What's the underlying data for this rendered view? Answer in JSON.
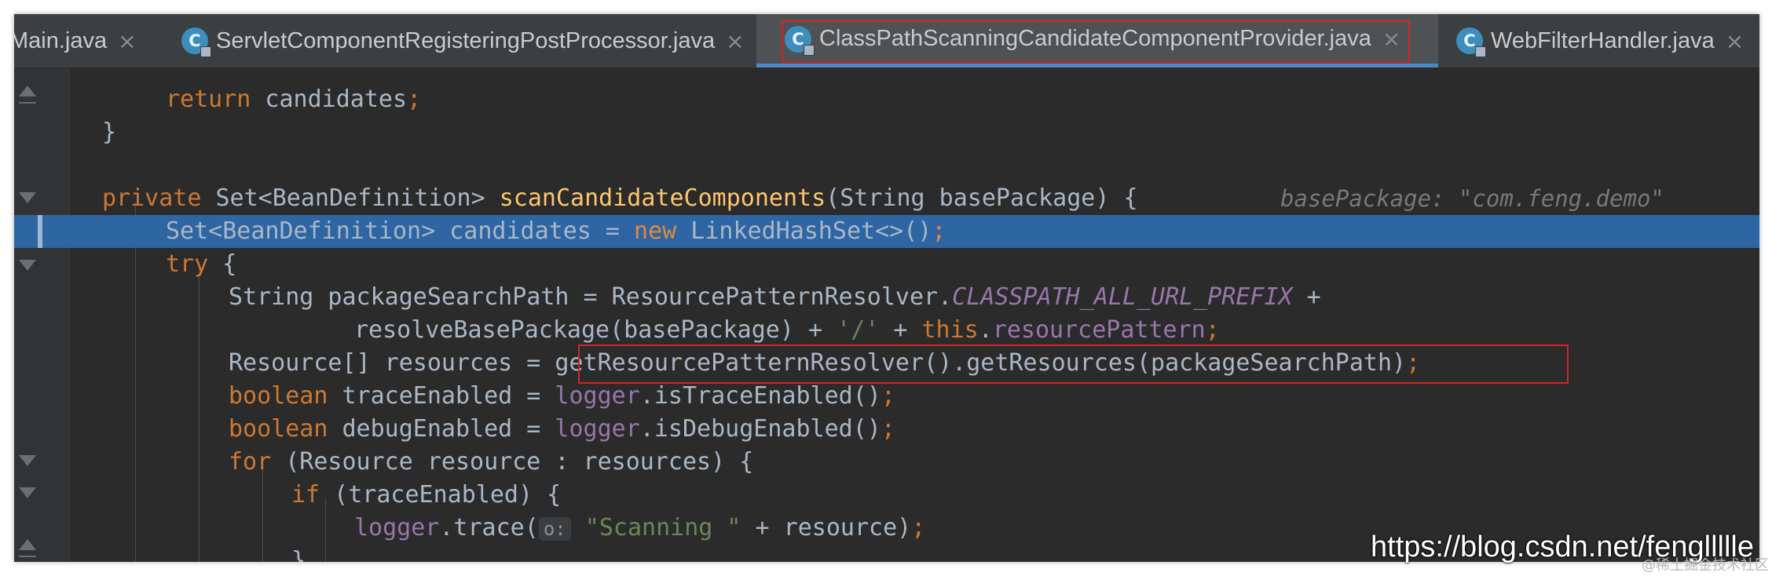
{
  "tabs": [
    {
      "label": "Main.java",
      "close": "×",
      "icon": "C"
    },
    {
      "label": "ServletComponentRegisteringPostProcessor.java",
      "close": "×",
      "icon": "C"
    },
    {
      "label": "ClassPathScanningCandidateComponentProvider.java",
      "close": "×",
      "icon": "C",
      "active": true
    },
    {
      "label": "WebFilterHandler.java",
      "close": "×",
      "icon": "C"
    }
  ],
  "code": {
    "l1": {
      "kw": "return",
      "rest": " candidates",
      "semi": ";"
    },
    "l2": {
      "brace": "}"
    },
    "l4": {
      "kw": "private",
      "type": " Set<BeanDefinition> ",
      "fn": "scanCandidateComponents",
      "params": "(String basePackage) {",
      "hint": "basePackage: \"com.feng.demo\""
    },
    "l5": {
      "a": "Set<BeanDefinition> candidates = ",
      "kw": "new",
      "b": " LinkedHashSet<>()",
      "semi": ";"
    },
    "l6": {
      "kw": "try",
      "rest": " {"
    },
    "l7": {
      "a": "String packageSearchPath = ResourcePatternResolver.",
      "const": "CLASSPATH_ALL_URL_PREFIX",
      "b": " +"
    },
    "l8": {
      "a": "resolveBasePackage(basePackage) + ",
      "str": "'/'",
      "b": " + ",
      "kw": "this",
      "c": ".",
      "fld": "resourcePattern",
      "semi": ";"
    },
    "l9": {
      "a": "Resource[] resources = ",
      "b": "getResourcePatternResolver().getResources(packageSearchPath)",
      "semi": ";"
    },
    "l10": {
      "kw": "boolean",
      "a": " traceEnabled = ",
      "fld": "logger",
      "b": ".isTraceEnabled()",
      "semi": ";"
    },
    "l11": {
      "kw": "boolean",
      "a": " debugEnabled = ",
      "fld": "logger",
      "b": ".isDebugEnabled()",
      "semi": ";"
    },
    "l12": {
      "kw": "for",
      "rest": " (Resource resource : resources) {"
    },
    "l13": {
      "kw": "if",
      "rest": " (traceEnabled) {"
    },
    "l14": {
      "fld": "logger",
      "a": ".trace(",
      "param": "o:",
      "str": "\"Scanning \"",
      "b": " + resource)",
      "semi": ";"
    },
    "l15": {
      "brace": "}"
    }
  },
  "watermark": {
    "url": "https://blog.csdn.net/fengllllle",
    "sub": "@稀土掘金技术社区"
  },
  "colors": {
    "keyword": "#cc7832",
    "method": "#ffc66d",
    "string": "#6a8759",
    "field": "#9876aa",
    "text": "#a9b7c6",
    "selection": "#2e65a3",
    "annotation_box": "#d32424"
  }
}
